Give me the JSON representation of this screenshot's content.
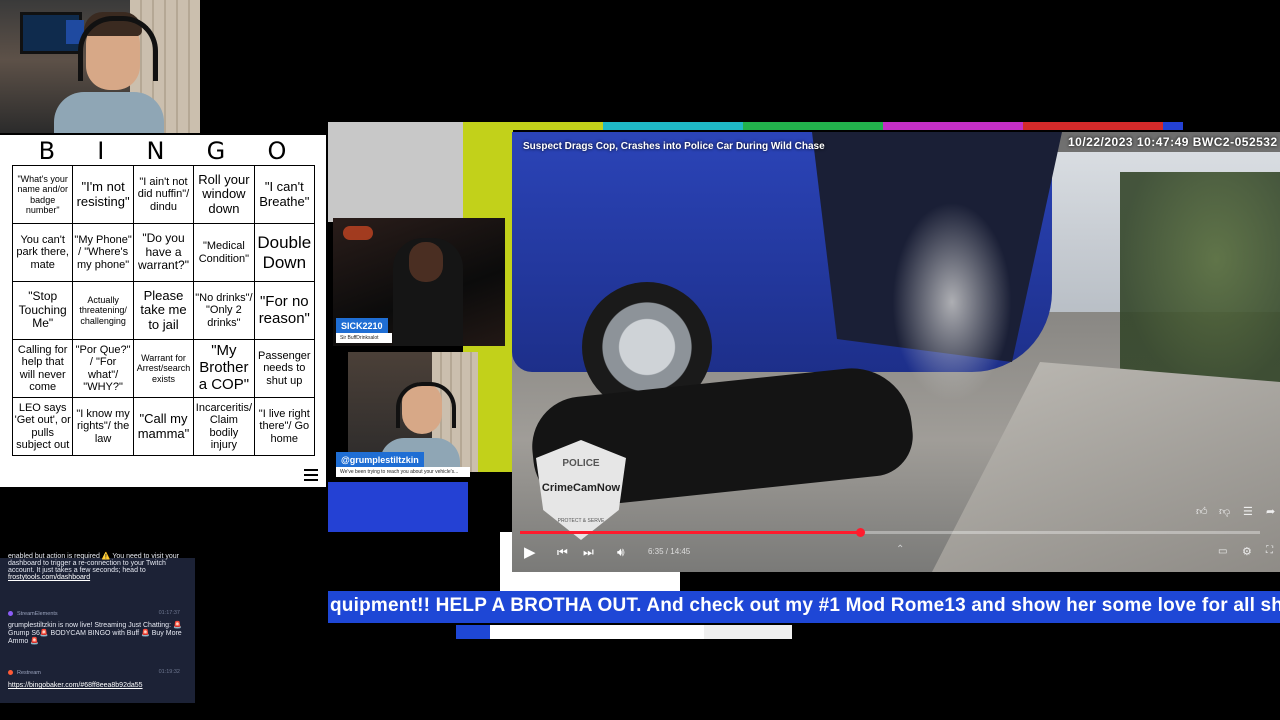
{
  "bingo": {
    "header": [
      "B",
      "I",
      "N",
      "G",
      "O"
    ],
    "cells": [
      {
        "text": "\"What's your name and/or badge number\"",
        "size": "s9"
      },
      {
        "text": "\"I'm not resisting\"",
        "size": "s13"
      },
      {
        "text": "\"I ain't not did nuffin\"/ dindu",
        "size": "s11"
      },
      {
        "text": "Roll your window down",
        "size": "s13"
      },
      {
        "text": "\"I can't Breathe\"",
        "size": "s13"
      },
      {
        "text": "You can't park there, mate",
        "size": "s11"
      },
      {
        "text": "\"My Phone\" / \"Where's my phone\"",
        "size": "s11"
      },
      {
        "text": "\"Do you have a warrant?\"",
        "size": "s12"
      },
      {
        "text": "\"Medical Condition\"",
        "size": "s11"
      },
      {
        "text": "Double Down",
        "size": "s17"
      },
      {
        "text": "\"Stop Touching Me\"",
        "size": "s12"
      },
      {
        "text": "Actually threatening/ challenging",
        "size": "s9"
      },
      {
        "text": "Please take me to jail",
        "size": "s13"
      },
      {
        "text": "\"No drinks\"/ \"Only 2 drinks\"",
        "size": "s11"
      },
      {
        "text": "\"For no reason\"",
        "size": "s15"
      },
      {
        "text": "Calling for help that will never come",
        "size": "s11"
      },
      {
        "text": "\"Por Que?\" / \"For what\"/ \"WHY?\"",
        "size": "s11"
      },
      {
        "text": "Warrant for Arrest/search exists",
        "size": "s9"
      },
      {
        "text": "\"My Brother a COP\"",
        "size": "s15"
      },
      {
        "text": "Passenger needs to shut up",
        "size": "s11"
      },
      {
        "text": "LEO says 'Get out', or pulls subject out",
        "size": "s11"
      },
      {
        "text": "\"I know my rights\"/ the law",
        "size": "s11"
      },
      {
        "text": "\"Call my mamma\"",
        "size": "s13"
      },
      {
        "text": "Incarceritis/ Claim bodily injury",
        "size": "s11"
      },
      {
        "text": "\"I live right there\"/ Go home",
        "size": "s11"
      }
    ]
  },
  "chat": {
    "messages": [
      {
        "user": "",
        "time": "",
        "text": "enabled but action is required ⚠️ You need to visit your dashboard to trigger a re-connection to your Twitch account. It just takes a few seconds; head to",
        "link": "frostytools.com/dashboard",
        "dot_color": ""
      },
      {
        "user": "StreamElements",
        "time": "01:17:37",
        "text": "grumplestiltzkin is now live! Streaming Just Chatting: 🚨Grump S6🚨 BODYCAM BINGO with Buff 🚨 Buy More Ammo 🚨",
        "link": "",
        "dot_color": "#8b5cf6"
      },
      {
        "user": "Restream",
        "time": "01:19:32",
        "text": "",
        "link": "https://bingobaker.com/#68ff8eea8b92da55",
        "dot_color": "#ff5a36"
      }
    ]
  },
  "cams": {
    "sick_name": "SICK2210",
    "sick_sub": "Sir BuffDrinksalot",
    "grump_name": "@grumplestiltzkin",
    "grump_sub": "We've been trying to reach you about your vehicle's..."
  },
  "video": {
    "title": "Suspect Drags Cop, Crashes into Police Car During Wild Chase",
    "timestamp": "10/22/2023 10:47:49 BWC2-052532",
    "watermark_top": "POLICE",
    "watermark_brand": "CrimeCamNow",
    "watermark_motto": "PROTECT & SERVE",
    "time_display": "6:35 / 14:45",
    "progress": 0.46
  },
  "ticker": {
    "text": "quipment!! HELP A BROTHA OUT. And check out my #1 Mod Rome13 and show her some love for all she"
  },
  "colors": {
    "ticker_blue": "#1e47d6",
    "progress_red": "#ff1b2d",
    "bar_colors": [
      "#c8c8c8",
      "#c2d11a",
      "#1fb9c6",
      "#22b24c",
      "#c42fc6",
      "#d42a2a",
      "#2441d4"
    ]
  }
}
